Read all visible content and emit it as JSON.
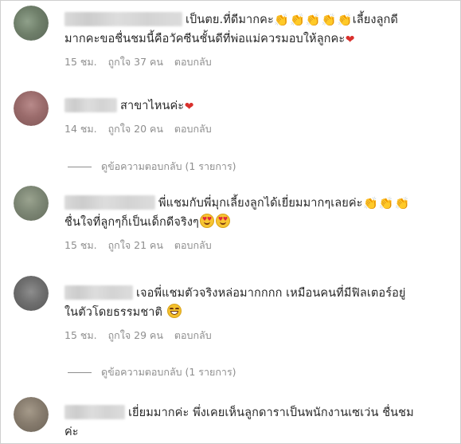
{
  "comments": [
    {
      "line1": "เป็นตย.ที่ดีมากคะ",
      "line1_after": "เลี้ยงลูกดี",
      "line2": "มากคะขอชื่นชมนี้คือวัคซีนชั้นดีที่พ่อแม่ควรมอบให้ลูกคะ",
      "time": "15 ชม.",
      "likes": "ถูกใจ 37 คน",
      "reply": "ตอบกลับ"
    },
    {
      "line1": "สาขาไหนค่ะ",
      "time": "14 ชม.",
      "likes": "ถูกใจ 20 คน",
      "reply": "ตอบกลับ"
    },
    {
      "line1": "พี่แชมกับพี่มุกเลี้ยงลูกได้เยี่ยมมากๆเลยค่ะ",
      "line2": "ชื่นใจที่ลูกๆก็เป็นเด็กดีจริงๆ",
      "time": "15 ชม.",
      "likes": "ถูกใจ 21 คน",
      "reply": "ตอบกลับ"
    },
    {
      "line1": "เจอพี่แชมตัวจริงหล่อมากกกก เหมือนคนที่มีฟิลเตอร์อยู่",
      "line2": "ในตัวโดยธรรมชาติ",
      "time": "15 ชม.",
      "likes": "ถูกใจ 29 คน",
      "reply": "ตอบกลับ"
    },
    {
      "line1": "เยี่ยมมากค่ะ พึ่งเคยเห็นลูกดาราเป็นพนักงานเซเว่น ชื่นชม",
      "line2": "ค่ะ"
    }
  ],
  "view_replies": [
    {
      "label": "ดูข้อความตอบกลับ (1 รายการ)"
    },
    {
      "label": "ดูข้อความตอบกลับ (1 รายการ)"
    }
  ],
  "emojis": {
    "clap": "👏",
    "heart": "❤",
    "heart_eyes": "😍",
    "grin_sweat": "😅"
  },
  "colors": {
    "text": "#262626",
    "meta": "#8e8e8e",
    "emoji_clap": "#d99a1a",
    "emoji_heart": "#d9302c",
    "emoji_face": "#f7c531"
  }
}
